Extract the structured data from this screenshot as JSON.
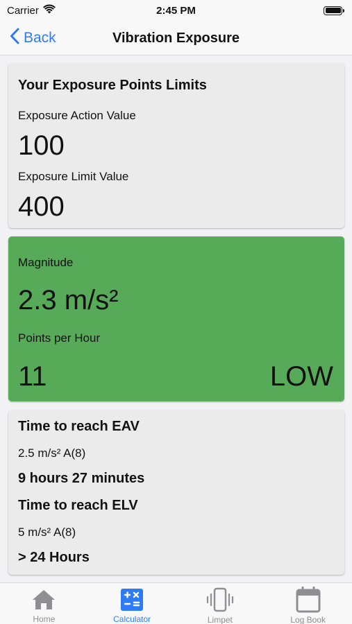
{
  "status_bar": {
    "carrier": "Carrier",
    "time": "2:45 PM"
  },
  "nav": {
    "back_label": "Back",
    "title": "Vibration Exposure"
  },
  "limits": {
    "heading": "Your Exposure Points Limits",
    "eav_label": "Exposure Action Value",
    "eav_value": "100",
    "elv_label": "Exposure Limit Value",
    "elv_value": "400"
  },
  "magnitude": {
    "label": "Magnitude",
    "value": "2.3 m/s²",
    "points_label": "Points per Hour",
    "points_value": "11",
    "level": "LOW",
    "color": "#57aa58"
  },
  "time": {
    "eav_heading": "Time to reach EAV",
    "eav_ref": "2.5 m/s² A(8)",
    "eav_duration": "9 hours 27 minutes",
    "elv_heading": "Time to reach ELV",
    "elv_ref": "5 m/s² A(8)",
    "elv_duration": "> 24 Hours"
  },
  "tabs": [
    {
      "label": "Home",
      "icon": "home-icon",
      "active": false
    },
    {
      "label": "Calculator",
      "icon": "calculator-icon",
      "active": true
    },
    {
      "label": "Limpet",
      "icon": "vibration-icon",
      "active": false
    },
    {
      "label": "Log Book",
      "icon": "calendar-icon",
      "active": false
    }
  ],
  "colors": {
    "accent": "#2d7cf6",
    "inactive": "#8e8e93",
    "card": "#ebebeb"
  }
}
